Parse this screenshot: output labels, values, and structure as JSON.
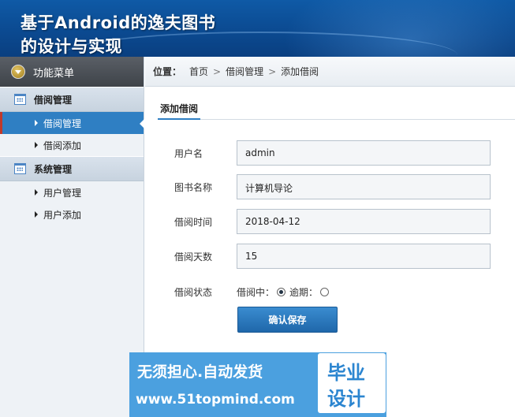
{
  "header": {
    "title_line1": "基于Android的逸夫图书",
    "title_line2": "的设计与实现"
  },
  "sidebar": {
    "menu_title": "功能菜单",
    "groups": [
      {
        "label": "借阅管理",
        "items": [
          {
            "label": "借阅管理",
            "active": true
          },
          {
            "label": "借阅添加",
            "active": false
          }
        ]
      },
      {
        "label": "系统管理",
        "items": [
          {
            "label": "用户管理",
            "active": false
          },
          {
            "label": "用户添加",
            "active": false
          }
        ]
      }
    ]
  },
  "breadcrumb": {
    "label": "位置：",
    "items": [
      "首页",
      "借阅管理",
      "添加借阅"
    ],
    "separator": ">"
  },
  "tab": {
    "label": "添加借阅"
  },
  "form": {
    "fields": [
      {
        "label": "用户名",
        "value": "admin"
      },
      {
        "label": "图书名称",
        "value": "计算机导论"
      },
      {
        "label": "借阅时间",
        "value": "2018-04-12"
      },
      {
        "label": "借阅天数",
        "value": "15"
      }
    ],
    "status": {
      "label": "借阅状态",
      "options": [
        {
          "label": "借阅中：",
          "selected": true
        },
        {
          "label": "逾期：",
          "selected": false
        }
      ]
    },
    "submit_label": "确认保存"
  },
  "watermark": {
    "line1": "无须担心.自动发货",
    "line2": "www.51topmind.com",
    "badge_line1": "毕业",
    "badge_line2": "设计"
  },
  "colors": {
    "header": "#0b4a91",
    "accent": "#2f7fc3",
    "active_marker": "#c0392b",
    "watermark": "#4ba0df"
  }
}
